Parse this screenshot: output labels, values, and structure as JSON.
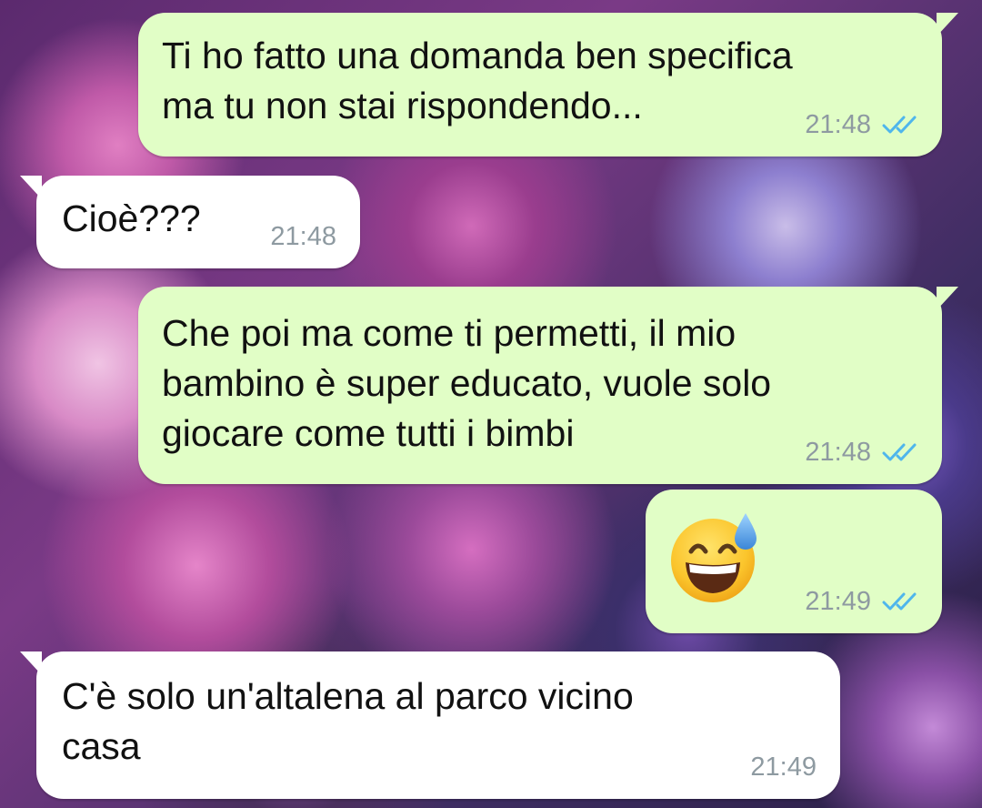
{
  "conversation": {
    "messages": [
      {
        "direction": "outgoing",
        "text": "Ti ho fatto una domanda ben specifica\nma tu non stai rispondendo...",
        "time": "21:48",
        "status_icon": "double-check-read-icon"
      },
      {
        "direction": "incoming",
        "text": "Cioè???",
        "time": "21:48"
      },
      {
        "direction": "outgoing",
        "text": "Che poi ma come ti permetti, il mio\nbambino è super educato, vuole solo\ngiocare come tutti i bimbi",
        "time": "21:48",
        "status_icon": "double-check-read-icon"
      },
      {
        "direction": "outgoing",
        "emoji": "grinning-face-with-sweat-emoji",
        "time": "21:49",
        "status_icon": "double-check-read-icon"
      },
      {
        "direction": "incoming",
        "text": "C'è solo un'altalena al parco vicino\ncasa",
        "time": "21:49"
      }
    ]
  },
  "colors": {
    "outgoing_bubble": "#e1fec6",
    "incoming_bubble": "#ffffff",
    "timestamp": "#8e9aa1",
    "read_ticks": "#4fb6ec"
  }
}
